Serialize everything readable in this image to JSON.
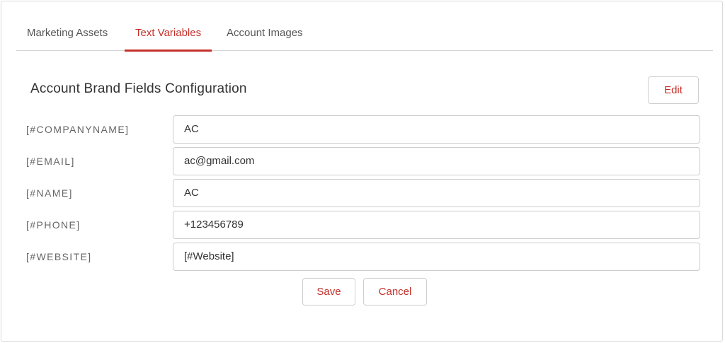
{
  "tabs": [
    {
      "label": "Marketing Assets",
      "active": false
    },
    {
      "label": "Text Variables",
      "active": true
    },
    {
      "label": "Account Images",
      "active": false
    }
  ],
  "section": {
    "title": "Account Brand Fields Configuration",
    "edit_label": "Edit"
  },
  "fields": [
    {
      "label": "[#COMPANYNAME]",
      "value": "AC"
    },
    {
      "label": "[#EMAIL]",
      "value": "ac@gmail.com"
    },
    {
      "label": "[#NAME]",
      "value": "AC"
    },
    {
      "label": "[#PHONE]",
      "value": "+123456789"
    },
    {
      "label": "[#WEBSITE]",
      "value": "[#Website]"
    }
  ],
  "actions": {
    "save_label": "Save",
    "cancel_label": "Cancel"
  },
  "colors": {
    "accent": "#c4302b",
    "border": "#cccccc",
    "label_text": "#666666"
  }
}
